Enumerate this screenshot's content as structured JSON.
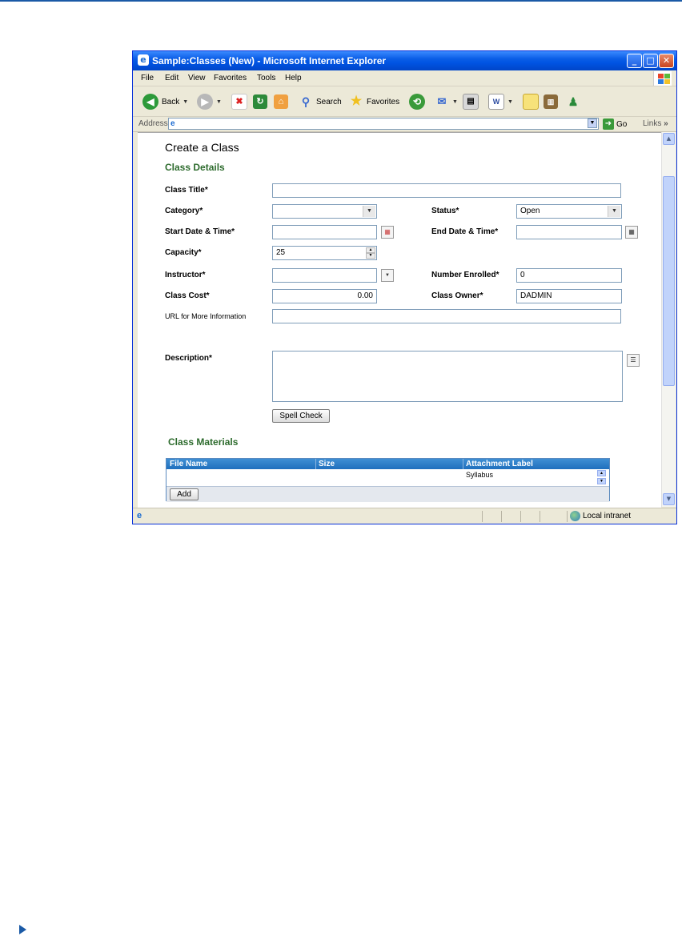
{
  "window": {
    "title": "Sample:Classes (New) - Microsoft Internet Explorer",
    "minimize": "_",
    "maximize": "□",
    "close": "✕"
  },
  "menu": [
    "File",
    "Edit",
    "View",
    "Favorites",
    "Tools",
    "Help"
  ],
  "toolbar": {
    "back_label": "Back",
    "search_label": "Search",
    "favorites_label": "Favorites"
  },
  "address": {
    "label": "Address",
    "value": "",
    "go_label": "Go",
    "links_label": "Links"
  },
  "form": {
    "heading": "Create a Class",
    "section_details": "Class Details",
    "class_title": {
      "label": "Class Title*",
      "value": ""
    },
    "category": {
      "label": "Category*",
      "value": ""
    },
    "status": {
      "label": "Status*",
      "value": "Open"
    },
    "start_date": {
      "label": "Start Date & Time*",
      "value": ""
    },
    "end_date": {
      "label": "End Date & Time*",
      "value": ""
    },
    "capacity": {
      "label": "Capacity*",
      "value": "25"
    },
    "instructor": {
      "label": "Instructor*",
      "value": ""
    },
    "number_enrolled": {
      "label": "Number Enrolled*",
      "value": "0"
    },
    "class_cost": {
      "label": "Class Cost*",
      "value": "0.00"
    },
    "class_owner": {
      "label": "Class Owner*",
      "value": "DADMIN"
    },
    "url": {
      "label": "URL for More Information",
      "value": ""
    },
    "description": {
      "label": "Description*",
      "value": ""
    },
    "spell_check": "Spell Check"
  },
  "materials": {
    "heading": "Class Materials",
    "columns": [
      "File Name",
      "Size",
      "Attachment Label"
    ],
    "rows": [
      {
        "file_name": "",
        "size": "",
        "label": "Syllabus"
      }
    ],
    "add_label": "Add"
  },
  "status_bar": {
    "zone": "Local intranet"
  },
  "colors": {
    "accent_rule": "#1a5aa6",
    "section_green": "#2d6b2d",
    "titlebar_blue": "#0054e3",
    "grid_header": "#1f6fbd"
  }
}
